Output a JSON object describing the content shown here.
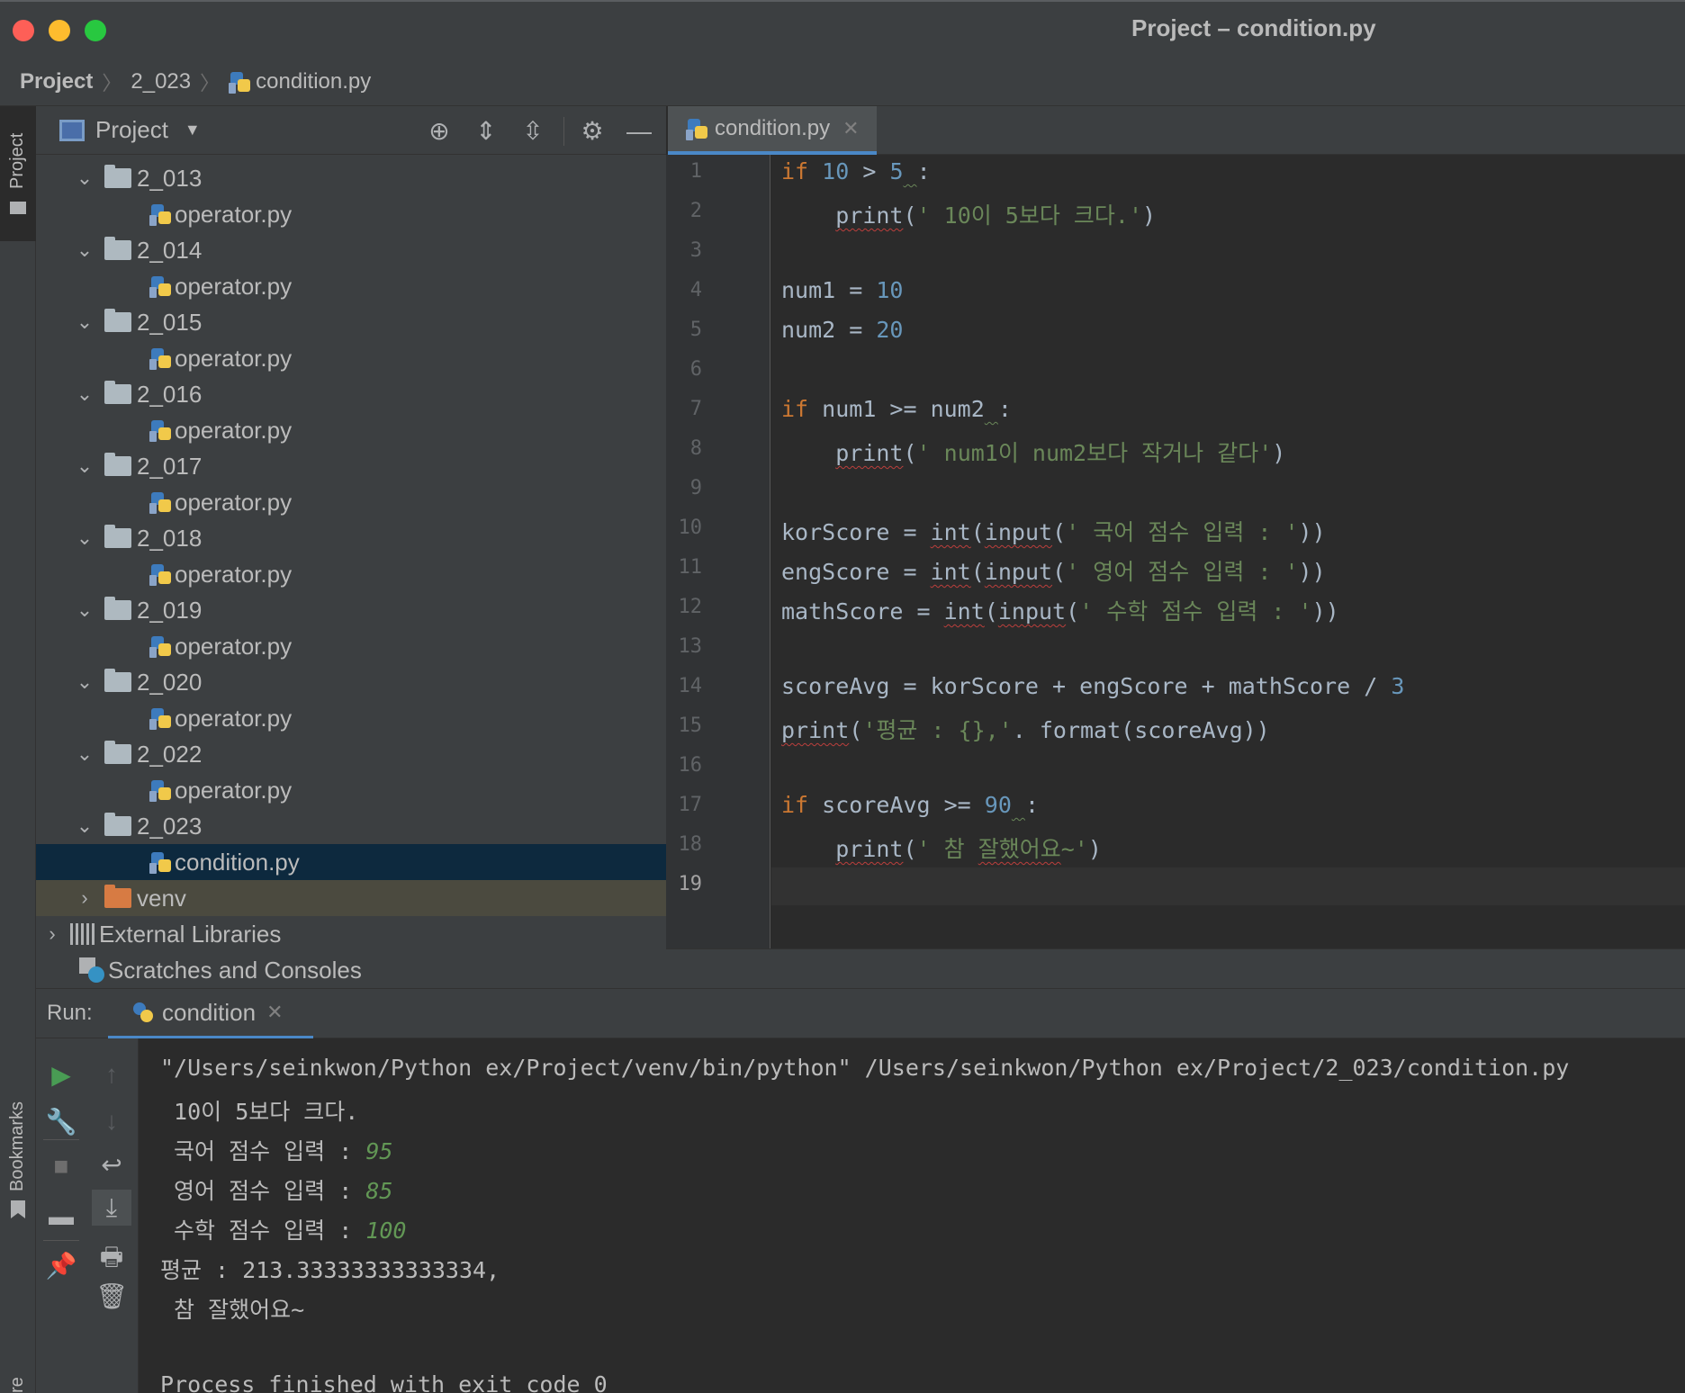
{
  "window": {
    "title": "Project – condition.py"
  },
  "breadcrumb": [
    "Project",
    "2_023",
    "condition.py"
  ],
  "left_strip": {
    "project_label": "Project",
    "bookmarks_label": "Bookmarks",
    "structure_label": "re"
  },
  "project_panel": {
    "title": "Project",
    "tree": [
      {
        "kind": "folder",
        "label": "2_013",
        "expanded": true
      },
      {
        "kind": "file",
        "label": "operator.py"
      },
      {
        "kind": "folder",
        "label": "2_014",
        "expanded": true
      },
      {
        "kind": "file",
        "label": "operator.py"
      },
      {
        "kind": "folder",
        "label": "2_015",
        "expanded": true
      },
      {
        "kind": "file",
        "label": "operator.py"
      },
      {
        "kind": "folder",
        "label": "2_016",
        "expanded": true
      },
      {
        "kind": "file",
        "label": "operator.py"
      },
      {
        "kind": "folder",
        "label": "2_017",
        "expanded": true
      },
      {
        "kind": "file",
        "label": "operator.py"
      },
      {
        "kind": "folder",
        "label": "2_018",
        "expanded": true
      },
      {
        "kind": "file",
        "label": "operator.py"
      },
      {
        "kind": "folder",
        "label": "2_019",
        "expanded": true
      },
      {
        "kind": "file",
        "label": "operator.py"
      },
      {
        "kind": "folder",
        "label": "2_020",
        "expanded": true
      },
      {
        "kind": "file",
        "label": "operator.py"
      },
      {
        "kind": "folder",
        "label": "2_022",
        "expanded": true
      },
      {
        "kind": "file",
        "label": "operator.py"
      },
      {
        "kind": "folder",
        "label": "2_023",
        "expanded": true
      },
      {
        "kind": "file",
        "label": "condition.py",
        "selected": true
      },
      {
        "kind": "folder",
        "label": "venv",
        "expanded": false
      },
      {
        "kind": "libraries",
        "label": "External Libraries"
      },
      {
        "kind": "scratches",
        "label": "Scratches and Consoles"
      }
    ]
  },
  "editor": {
    "tab_label": "condition.py",
    "current_line": 19,
    "line_numbers": [
      "1",
      "2",
      "3",
      "4",
      "5",
      "6",
      "7",
      "8",
      "9",
      "10",
      "11",
      "12",
      "13",
      "14",
      "15",
      "16",
      "17",
      "18",
      "19"
    ]
  },
  "run": {
    "label": "Run:",
    "tab_label": "condition",
    "output": {
      "cmd": "\"/Users/seinkwon/Python ex/Project/venv/bin/python\" /Users/seinkwon/Python ex/Project/2_023/condition.py",
      "l1": " 10이 5보다 크다.",
      "kor_prompt": " 국어 점수 입력 : ",
      "kor_val": "95",
      "eng_prompt": " 영어 점수 입력 : ",
      "eng_val": "85",
      "math_prompt": " 수학 점수 입력 : ",
      "math_val": "100",
      "avg": "평균 : 213.33333333333334,",
      "praise": " 참 잘했어요~",
      "exit": "Process finished with exit code 0"
    }
  },
  "colors": {
    "accent": "#4a88c7",
    "keyword": "#cc7832",
    "number": "#6897bb",
    "string": "#6a8759",
    "selection": "#0d293e"
  }
}
